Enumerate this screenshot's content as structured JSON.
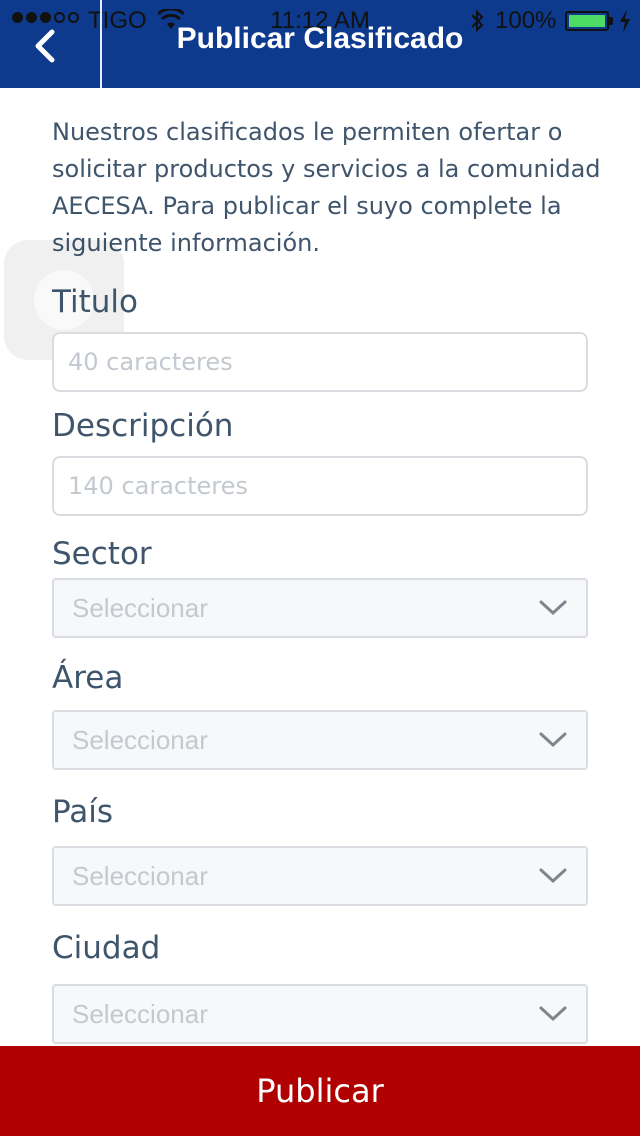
{
  "status_bar": {
    "carrier": "TIGO",
    "time": "11:12 AM",
    "battery": "100%"
  },
  "header": {
    "title": "Publicar Clasificado",
    "back_icon": "chevron-left-icon",
    "color": "#0d3a8c"
  },
  "intro": "Nuestros clasificados le permiten ofertar o solicitar productos y servicios a la comunidad AECESA. Para publicar el suyo complete la siguiente información.",
  "form": {
    "titulo": {
      "label": "Titulo",
      "placeholder": "40 caracteres"
    },
    "descripcion": {
      "label": "Descripción",
      "placeholder": "140 caracteres"
    },
    "sector": {
      "label": "Sector",
      "value": "Seleccionar"
    },
    "area": {
      "label": "Área",
      "value": "Seleccionar"
    },
    "pais": {
      "label": "País",
      "value": "Seleccionar"
    },
    "ciudad": {
      "label": "Ciudad",
      "value": "Seleccionar"
    }
  },
  "publish_button": {
    "label": "Publicar",
    "color": "#b10000"
  }
}
